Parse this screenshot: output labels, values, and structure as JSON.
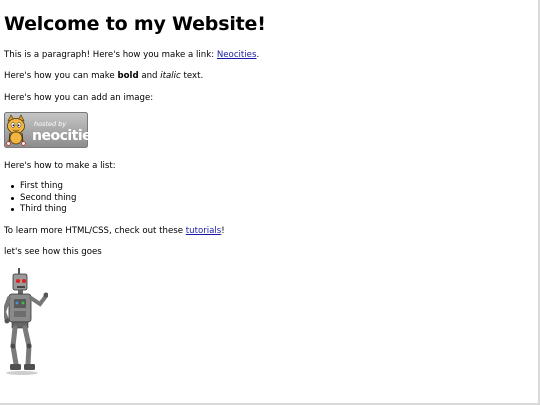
{
  "heading": "Welcome to my Website!",
  "paragraph1": {
    "text": "This is a paragraph! Here's how you make a link: ",
    "link": "Neocities",
    "end": "."
  },
  "paragraph2": {
    "before": "Here's how you can make ",
    "bold": "bold",
    "middle": " and ",
    "italic": "italic",
    "after": " text."
  },
  "paragraph3": "Here's how you can add an image:",
  "badge": {
    "line1": "hosted by",
    "line2": "neocities"
  },
  "paragraph4": "Here's how to make a list:",
  "list": [
    "First thing",
    "Second thing",
    "Third thing"
  ],
  "paragraph5": {
    "before": "To learn more HTML/CSS, check out these ",
    "link": "tutorials",
    "after": "!"
  },
  "paragraph6": "let's see how this goes"
}
